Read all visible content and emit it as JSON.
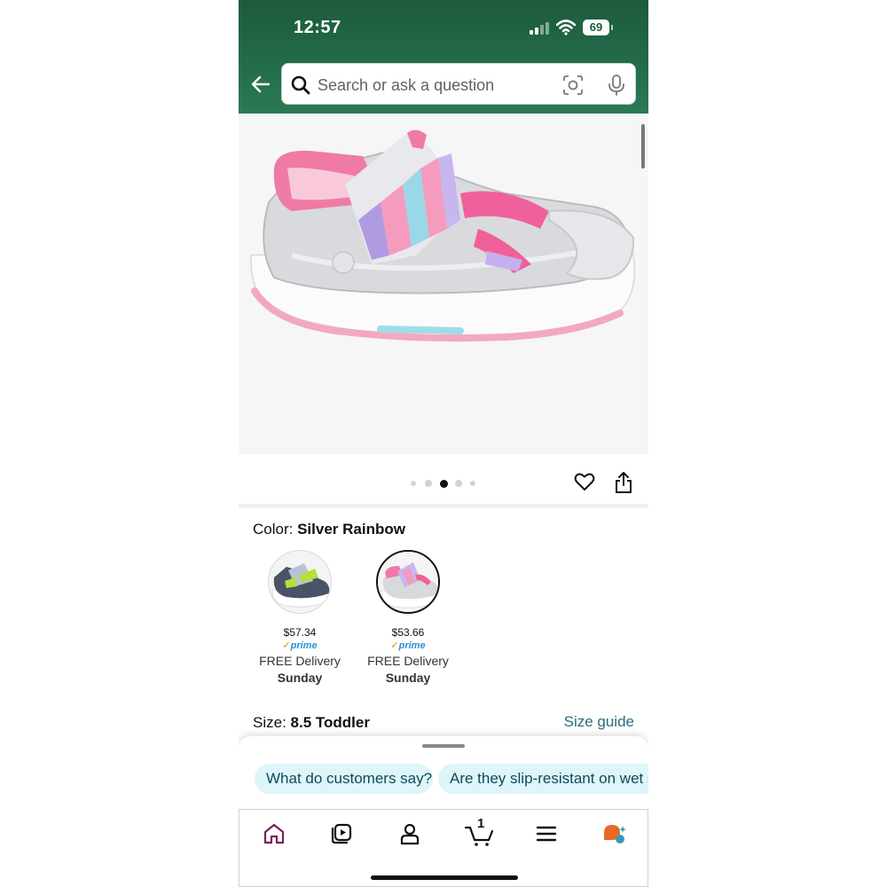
{
  "status_bar": {
    "time": "12:57",
    "battery": "69"
  },
  "search": {
    "placeholder": "Search or ask a question"
  },
  "colors": {
    "header": "#236b4a",
    "accent_link": "#2a6b7a",
    "chip_bg": "#def5fa",
    "prime": "#2a8fd6"
  },
  "carousel": {
    "count": 5,
    "active_index": 2
  },
  "product": {
    "color_label": "Color:",
    "color_value": "Silver Rainbow",
    "size_label": "Size:",
    "size_value": "8.5 Toddler",
    "size_guide": "Size guide"
  },
  "swatches": [
    {
      "name": "navy-lime",
      "price": "$57.34",
      "prime": "prime",
      "delivery": "FREE Delivery",
      "day": "Sunday",
      "selected": false
    },
    {
      "name": "silver-rainbow",
      "price": "$53.66",
      "prime": "prime",
      "delivery": "FREE Delivery",
      "day": "Sunday",
      "selected": true
    }
  ],
  "suggestions": [
    "What do customers say?",
    "Are they slip-resistant on wet s"
  ],
  "nav": {
    "items": [
      "home-icon",
      "video-icon",
      "account-icon",
      "cart-icon",
      "menu-icon",
      "rufus-icon"
    ],
    "cart_count": "1"
  }
}
